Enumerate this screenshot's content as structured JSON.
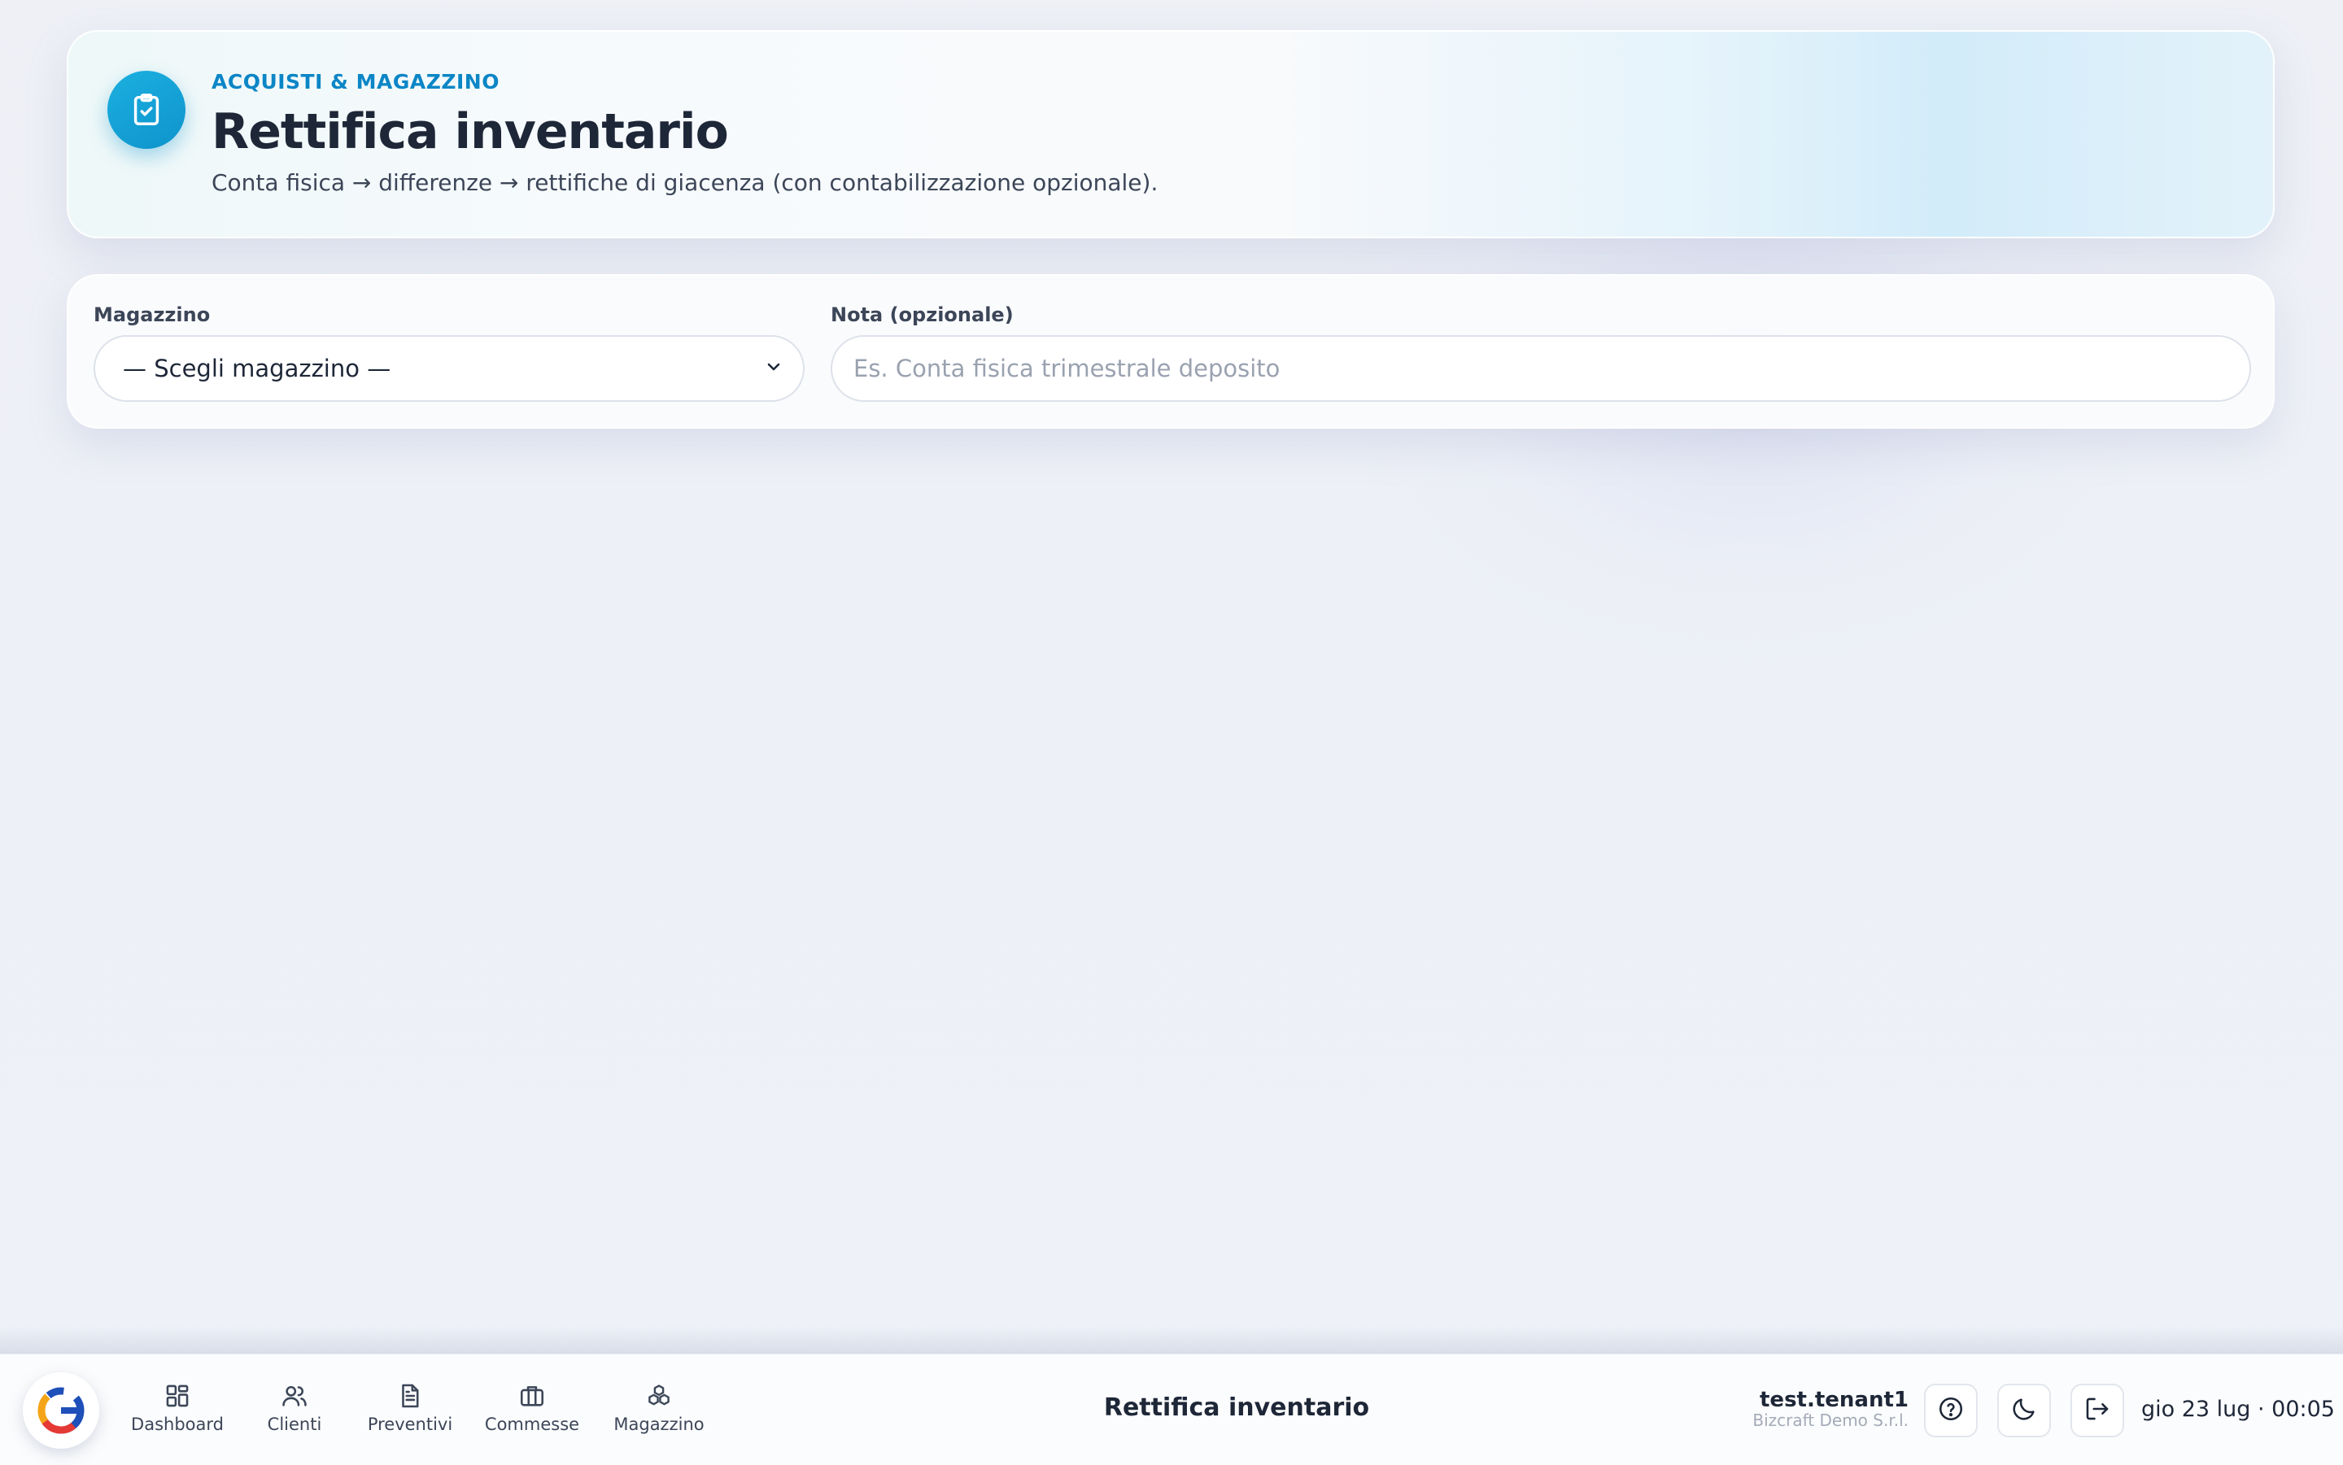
{
  "header": {
    "eyebrow": "ACQUISTI & MAGAZZINO",
    "title": "Rettifica inventario",
    "subtitle": "Conta fisica → differenze → rettifiche di giacenza (con contabilizzazione opzionale).",
    "badge_icon": "clipboard-check-icon"
  },
  "form": {
    "warehouse_label": "Magazzino",
    "warehouse_selected": "— Scegli magazzino —",
    "note_label": "Nota (opzionale)",
    "note_value": "",
    "note_placeholder": "Es. Conta fisica trimestrale deposito"
  },
  "bottombar": {
    "nav": [
      {
        "label": "Dashboard",
        "icon": "dashboard-grid-icon"
      },
      {
        "label": "Clienti",
        "icon": "users-icon"
      },
      {
        "label": "Preventivi",
        "icon": "document-icon"
      },
      {
        "label": "Commesse",
        "icon": "briefcase-icon"
      },
      {
        "label": "Magazzino",
        "icon": "boxes-icon"
      }
    ],
    "page_title": "Rettifica inventario",
    "user": {
      "name": "test.tenant1",
      "company": "Bizcraft Demo S.r.l."
    },
    "datetime": "gio 23 lug · 00:05"
  },
  "colors": {
    "accent": "#0b86c6",
    "badge": "#1aa7dc",
    "text": "#1e2738",
    "muted": "#3c4658"
  }
}
